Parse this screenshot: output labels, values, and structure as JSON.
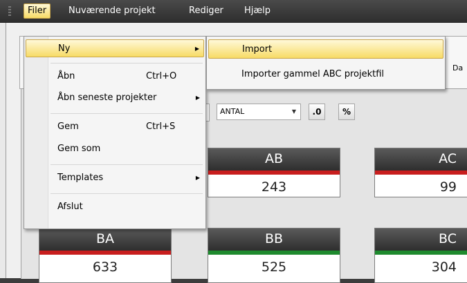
{
  "menubar": {
    "items": [
      "Filer",
      "Nuværende projekt",
      "Rediger",
      "Hjælp"
    ]
  },
  "file_menu": {
    "items": [
      {
        "label": "Ny",
        "shortcut": "",
        "submenu": true,
        "highlighted": true
      },
      {
        "label": "Åbn",
        "shortcut": "Ctrl+O",
        "submenu": false
      },
      {
        "label": "Åbn seneste projekter",
        "shortcut": "",
        "submenu": true
      },
      {
        "label": "Gem",
        "shortcut": "Ctrl+S",
        "submenu": false
      },
      {
        "label": "Gem som",
        "shortcut": "",
        "submenu": false
      },
      {
        "label": "Templates",
        "shortcut": "",
        "submenu": true
      },
      {
        "label": "Afslut",
        "shortcut": "",
        "submenu": false
      }
    ]
  },
  "new_submenu": {
    "items": [
      {
        "label": "Import",
        "highlighted": true
      },
      {
        "label": "Importer gammel ABC projektfil"
      }
    ]
  },
  "ribbon": {
    "partial_label": "Da"
  },
  "toolbar": {
    "measure_select": "ANTAL",
    "decimal_button": ".0",
    "percent_button": "%"
  },
  "tiles": [
    {
      "label": "AB",
      "value": "243",
      "bar_color": "#c81e1e"
    },
    {
      "label": "AC",
      "value": "99",
      "bar_color": "#c81e1e"
    },
    {
      "label": "BA",
      "value": "633",
      "bar_color": "#c81e1e"
    },
    {
      "label": "BB",
      "value": "525",
      "bar_color": "#1e8a2e"
    },
    {
      "label": "BC",
      "value": "304",
      "bar_color": "#1e8a2e"
    }
  ],
  "colors": {
    "menu_highlight": "#f7db66",
    "menubar": "#3a3a3a"
  }
}
